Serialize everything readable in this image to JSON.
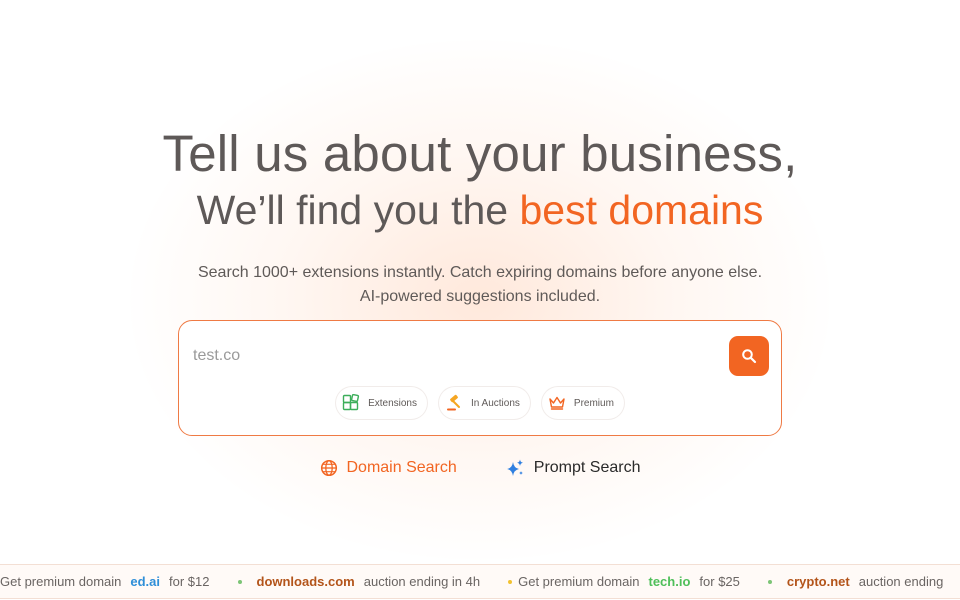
{
  "hero": {
    "line1": "Tell us about your business,",
    "line2_prefix": "We’ll find you the ",
    "line2_accent": "best domains",
    "subtitle_line1": "Search 1000+ extensions instantly. Catch expiring domains before anyone else.",
    "subtitle_line2": "AI-powered suggestions included."
  },
  "search": {
    "placeholder": "test.co",
    "value": "",
    "chips": [
      {
        "label": "Extensions",
        "icon": "extensions-icon"
      },
      {
        "label": "In Auctions",
        "icon": "gavel-icon"
      },
      {
        "label": "Premium",
        "icon": "crown-icon"
      }
    ]
  },
  "modes": {
    "domain": "Domain Search",
    "prompt": "Prompt Search"
  },
  "ticker": {
    "items": [
      {
        "lead": "Get premium domain",
        "domain": "ed.ai",
        "trail": "for $12",
        "color": "#2f8fd8",
        "dot": ""
      },
      {
        "lead": "",
        "domain": "downloads.com",
        "trail": "auction ending in 4h",
        "color": "#b3541a",
        "dot": "#7cc576"
      },
      {
        "lead": "Get premium domain",
        "domain": "tech.io",
        "trail": "for $25",
        "color": "#4fbf5a",
        "dot": "#f2c230"
      },
      {
        "lead": "",
        "domain": "crypto.net",
        "trail": "auction ending",
        "color": "#b3541a",
        "dot": "#7cc576"
      }
    ]
  },
  "colors": {
    "accent": "#f26522",
    "text": "#5e5958",
    "border": "#ef7a44"
  }
}
